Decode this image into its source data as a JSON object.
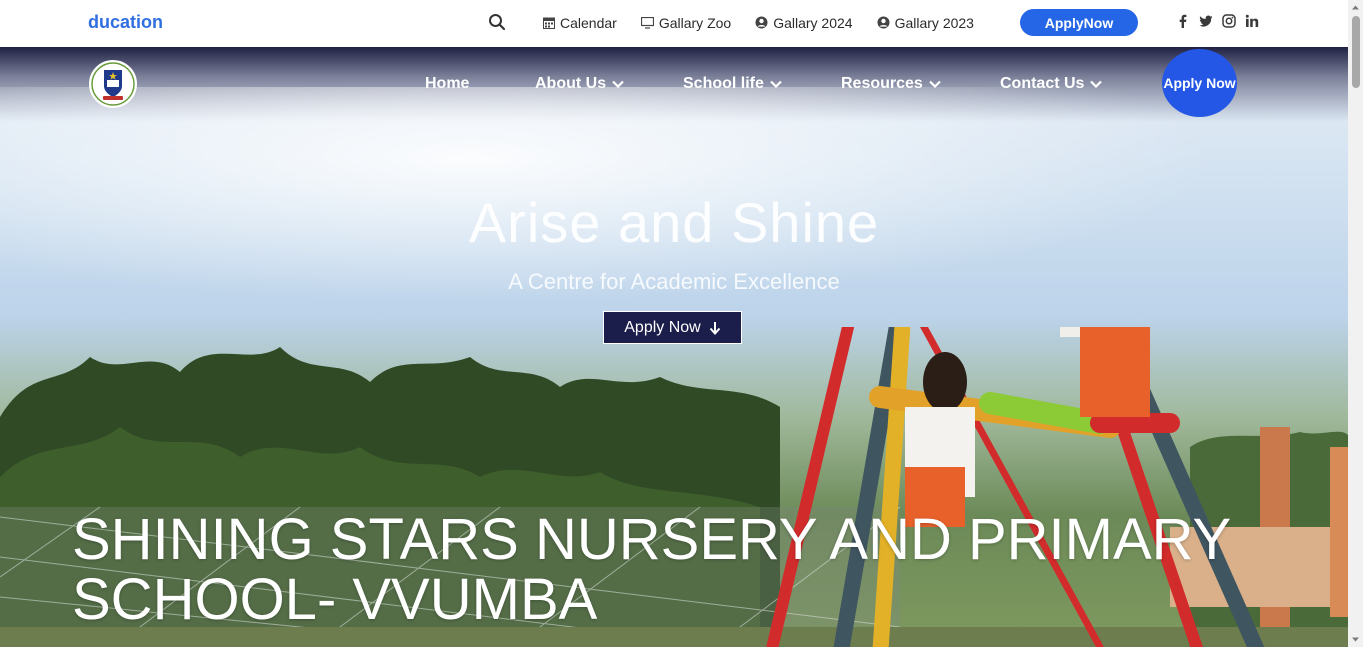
{
  "topbar": {
    "brand": "ducation",
    "links": [
      {
        "label": "Calendar",
        "icon": "calendar-icon"
      },
      {
        "label": "Gallary Zoo",
        "icon": "monitor-icon"
      },
      {
        "label": "Gallary 2024",
        "icon": "user-circle-icon"
      },
      {
        "label": "Gallary 2023",
        "icon": "user-circle-icon"
      }
    ],
    "apply_label": "ApplyNow",
    "socials": [
      "facebook-icon",
      "twitter-icon",
      "instagram-icon",
      "linkedin-icon"
    ]
  },
  "nav": {
    "items": [
      {
        "label": "Home",
        "dropdown": false
      },
      {
        "label": "About Us",
        "dropdown": true
      },
      {
        "label": "School life",
        "dropdown": true
      },
      {
        "label": "Resources",
        "dropdown": true
      },
      {
        "label": "Contact Us",
        "dropdown": true
      }
    ],
    "apply_label": "Apply Now"
  },
  "hero": {
    "title": "Arise and Shine",
    "subtitle": "A Centre for Academic Excellence",
    "cta_label": "Apply Now",
    "school_name": "SHINING STARS NURSERY AND PRIMARY SCHOOL- VVUMBA"
  },
  "colors": {
    "brand_blue": "#2f6fe0",
    "apply_blue": "#2466e6",
    "cta_navy": "#1b1d4a"
  }
}
